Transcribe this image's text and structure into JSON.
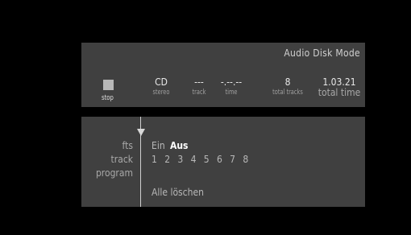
{
  "status": {
    "mode_title": "Audio Disk Mode",
    "stop_label": "stop",
    "disc_type": "CD",
    "disc_mode": "stereo",
    "track_value": "---",
    "track_label": "track",
    "time_value": "-.--.--",
    "time_label": "time",
    "total_tracks_value": "8",
    "total_tracks_label": "total tracks",
    "total_time_value": "1.03.21",
    "total_time_label": "total time"
  },
  "controls": {
    "fts_label": "fts",
    "track_label": "track",
    "program_label": "program",
    "fts_options": [
      "Ein",
      "Aus"
    ],
    "fts_selected": "Aus",
    "tracks": [
      "1",
      "2",
      "3",
      "4",
      "5",
      "6",
      "7",
      "8"
    ],
    "clear_label": "Alle löschen"
  }
}
